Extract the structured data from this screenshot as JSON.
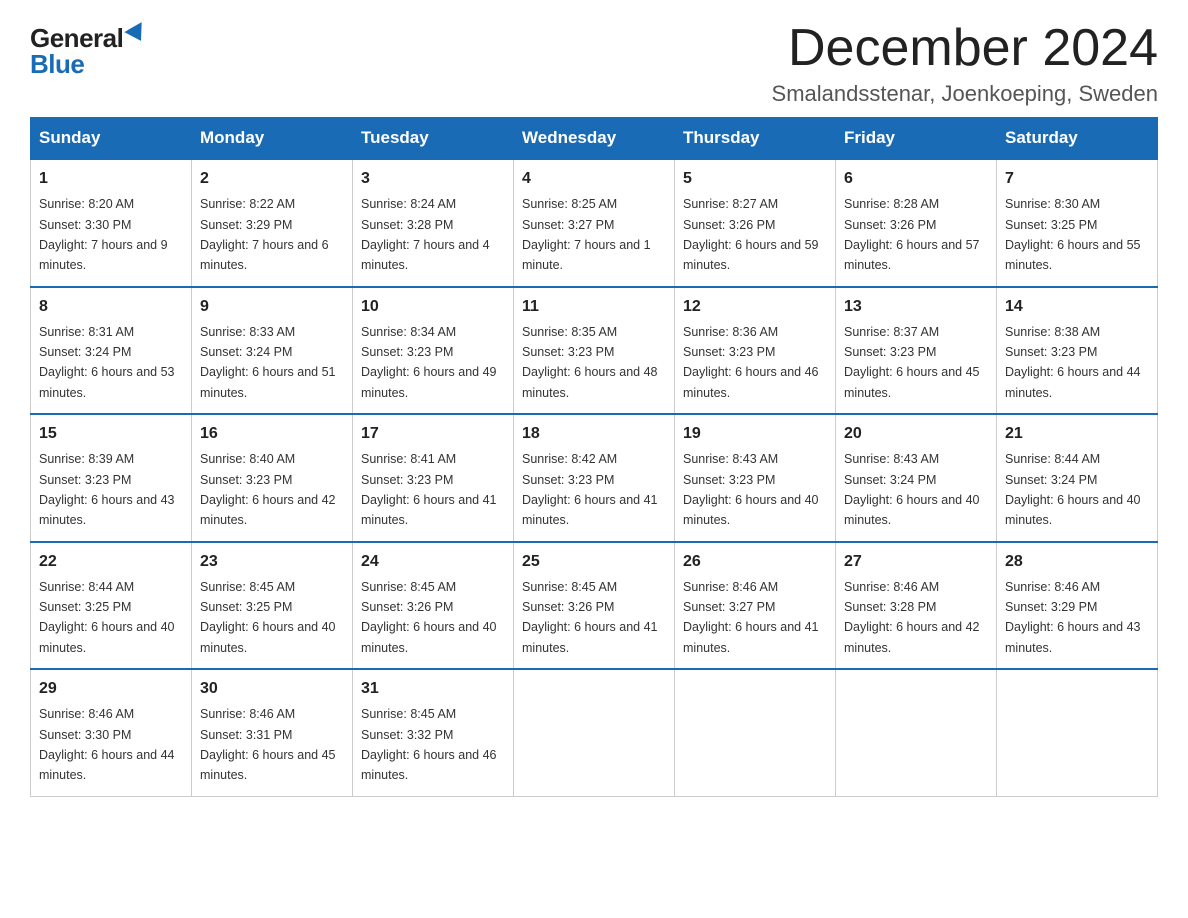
{
  "header": {
    "logo_general": "General",
    "logo_blue": "Blue",
    "month_title": "December 2024",
    "location": "Smalandsstenar, Joenkoeping, Sweden"
  },
  "weekdays": [
    "Sunday",
    "Monday",
    "Tuesday",
    "Wednesday",
    "Thursday",
    "Friday",
    "Saturday"
  ],
  "weeks": [
    [
      {
        "day": "1",
        "sunrise": "8:20 AM",
        "sunset": "3:30 PM",
        "daylight": "7 hours and 9 minutes."
      },
      {
        "day": "2",
        "sunrise": "8:22 AM",
        "sunset": "3:29 PM",
        "daylight": "7 hours and 6 minutes."
      },
      {
        "day": "3",
        "sunrise": "8:24 AM",
        "sunset": "3:28 PM",
        "daylight": "7 hours and 4 minutes."
      },
      {
        "day": "4",
        "sunrise": "8:25 AM",
        "sunset": "3:27 PM",
        "daylight": "7 hours and 1 minute."
      },
      {
        "day": "5",
        "sunrise": "8:27 AM",
        "sunset": "3:26 PM",
        "daylight": "6 hours and 59 minutes."
      },
      {
        "day": "6",
        "sunrise": "8:28 AM",
        "sunset": "3:26 PM",
        "daylight": "6 hours and 57 minutes."
      },
      {
        "day": "7",
        "sunrise": "8:30 AM",
        "sunset": "3:25 PM",
        "daylight": "6 hours and 55 minutes."
      }
    ],
    [
      {
        "day": "8",
        "sunrise": "8:31 AM",
        "sunset": "3:24 PM",
        "daylight": "6 hours and 53 minutes."
      },
      {
        "day": "9",
        "sunrise": "8:33 AM",
        "sunset": "3:24 PM",
        "daylight": "6 hours and 51 minutes."
      },
      {
        "day": "10",
        "sunrise": "8:34 AM",
        "sunset": "3:23 PM",
        "daylight": "6 hours and 49 minutes."
      },
      {
        "day": "11",
        "sunrise": "8:35 AM",
        "sunset": "3:23 PM",
        "daylight": "6 hours and 48 minutes."
      },
      {
        "day": "12",
        "sunrise": "8:36 AM",
        "sunset": "3:23 PM",
        "daylight": "6 hours and 46 minutes."
      },
      {
        "day": "13",
        "sunrise": "8:37 AM",
        "sunset": "3:23 PM",
        "daylight": "6 hours and 45 minutes."
      },
      {
        "day": "14",
        "sunrise": "8:38 AM",
        "sunset": "3:23 PM",
        "daylight": "6 hours and 44 minutes."
      }
    ],
    [
      {
        "day": "15",
        "sunrise": "8:39 AM",
        "sunset": "3:23 PM",
        "daylight": "6 hours and 43 minutes."
      },
      {
        "day": "16",
        "sunrise": "8:40 AM",
        "sunset": "3:23 PM",
        "daylight": "6 hours and 42 minutes."
      },
      {
        "day": "17",
        "sunrise": "8:41 AM",
        "sunset": "3:23 PM",
        "daylight": "6 hours and 41 minutes."
      },
      {
        "day": "18",
        "sunrise": "8:42 AM",
        "sunset": "3:23 PM",
        "daylight": "6 hours and 41 minutes."
      },
      {
        "day": "19",
        "sunrise": "8:43 AM",
        "sunset": "3:23 PM",
        "daylight": "6 hours and 40 minutes."
      },
      {
        "day": "20",
        "sunrise": "8:43 AM",
        "sunset": "3:24 PM",
        "daylight": "6 hours and 40 minutes."
      },
      {
        "day": "21",
        "sunrise": "8:44 AM",
        "sunset": "3:24 PM",
        "daylight": "6 hours and 40 minutes."
      }
    ],
    [
      {
        "day": "22",
        "sunrise": "8:44 AM",
        "sunset": "3:25 PM",
        "daylight": "6 hours and 40 minutes."
      },
      {
        "day": "23",
        "sunrise": "8:45 AM",
        "sunset": "3:25 PM",
        "daylight": "6 hours and 40 minutes."
      },
      {
        "day": "24",
        "sunrise": "8:45 AM",
        "sunset": "3:26 PM",
        "daylight": "6 hours and 40 minutes."
      },
      {
        "day": "25",
        "sunrise": "8:45 AM",
        "sunset": "3:26 PM",
        "daylight": "6 hours and 41 minutes."
      },
      {
        "day": "26",
        "sunrise": "8:46 AM",
        "sunset": "3:27 PM",
        "daylight": "6 hours and 41 minutes."
      },
      {
        "day": "27",
        "sunrise": "8:46 AM",
        "sunset": "3:28 PM",
        "daylight": "6 hours and 42 minutes."
      },
      {
        "day": "28",
        "sunrise": "8:46 AM",
        "sunset": "3:29 PM",
        "daylight": "6 hours and 43 minutes."
      }
    ],
    [
      {
        "day": "29",
        "sunrise": "8:46 AM",
        "sunset": "3:30 PM",
        "daylight": "6 hours and 44 minutes."
      },
      {
        "day": "30",
        "sunrise": "8:46 AM",
        "sunset": "3:31 PM",
        "daylight": "6 hours and 45 minutes."
      },
      {
        "day": "31",
        "sunrise": "8:45 AM",
        "sunset": "3:32 PM",
        "daylight": "6 hours and 46 minutes."
      },
      null,
      null,
      null,
      null
    ]
  ],
  "labels": {
    "sunrise": "Sunrise:",
    "sunset": "Sunset:",
    "daylight": "Daylight:"
  }
}
